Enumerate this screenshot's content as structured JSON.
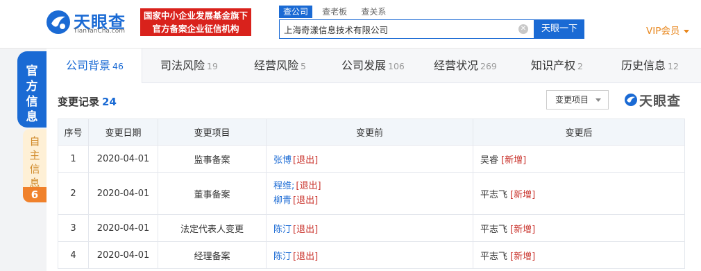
{
  "header": {
    "logo_name": "天眼查",
    "logo_url": "TianYanCha.com",
    "badge_line1": "国家中小企业发展基金旗下",
    "badge_line2": "官方备案企业征信机构",
    "search_tabs": [
      "查公司",
      "查老板",
      "查关系"
    ],
    "search_value": "上海奇漾信息技术有限公司",
    "search_button": "天眼一下",
    "vip_label": "VIP会员"
  },
  "side_tabs": {
    "official": "官方信息",
    "self": "自主信息",
    "self_count": "6"
  },
  "nav": [
    {
      "label": "公司背景",
      "count": "46"
    },
    {
      "label": "司法风险",
      "count": "19"
    },
    {
      "label": "经营风险",
      "count": "5"
    },
    {
      "label": "公司发展",
      "count": "106"
    },
    {
      "label": "经营状况",
      "count": "269"
    },
    {
      "label": "知识产权",
      "count": "2"
    },
    {
      "label": "历史信息",
      "count": "12"
    }
  ],
  "section": {
    "title": "变更记录",
    "count": "24",
    "filter_label": "变更项目",
    "watermark": "天眼查"
  },
  "table": {
    "headers": [
      "序号",
      "变更日期",
      "变更项目",
      "变更前",
      "变更后"
    ],
    "out_tag": "[退出]",
    "new_tag": "[新增]",
    "rows": [
      {
        "no": "1",
        "date": "2020-04-01",
        "item": "监事备案",
        "before": [
          "张博"
        ],
        "after": "吴睿"
      },
      {
        "no": "2",
        "date": "2020-04-01",
        "item": "董事备案",
        "before": [
          "程维;",
          "柳青"
        ],
        "after": "平志飞"
      },
      {
        "no": "3",
        "date": "2020-04-01",
        "item": "法定代表人变更",
        "before": [
          "陈汀"
        ],
        "after": "平志飞"
      },
      {
        "no": "4",
        "date": "2020-04-01",
        "item": "经理备案",
        "before": [
          "陈汀"
        ],
        "after": "平志飞"
      }
    ]
  },
  "colors": {
    "brand": "#1a6ad4",
    "badge_red": "#d9221c",
    "vip_orange": "#e8871e",
    "tag_red": "#c9322b"
  }
}
